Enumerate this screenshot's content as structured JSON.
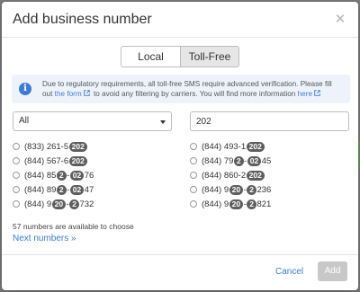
{
  "modal": {
    "title": "Add business number",
    "close_icon": "close-icon"
  },
  "tabs": [
    {
      "label": "Local",
      "active": false
    },
    {
      "label": "Toll-Free",
      "active": true
    }
  ],
  "notice": {
    "icon": "info-icon",
    "text_1": "Due to regulatory requirements, all toll-free SMS require advanced verification. Please fill out ",
    "link_1": "the form",
    "text_2": " to avoid any filtering by carriers. You will find more information ",
    "link_2": "here"
  },
  "filter": {
    "selected": "All",
    "search_value": "202"
  },
  "numbers": {
    "left": [
      [
        {
          "t": "(833) 261-5",
          "h": false
        },
        {
          "t": "202",
          "h": true
        }
      ],
      [
        {
          "t": "(844) 567-6",
          "h": false
        },
        {
          "t": "202",
          "h": true
        }
      ],
      [
        {
          "t": "(844) 85",
          "h": false
        },
        {
          "t": "2",
          "h": true
        },
        {
          "t": "-",
          "h": false
        },
        {
          "t": "02",
          "h": true
        },
        {
          "t": "76",
          "h": false
        }
      ],
      [
        {
          "t": "(844) 89",
          "h": false
        },
        {
          "t": "2",
          "h": true
        },
        {
          "t": "-",
          "h": false
        },
        {
          "t": "02",
          "h": true
        },
        {
          "t": "47",
          "h": false
        }
      ],
      [
        {
          "t": "(844) 9",
          "h": false
        },
        {
          "t": "20",
          "h": true
        },
        {
          "t": "-",
          "h": false
        },
        {
          "t": "2",
          "h": true
        },
        {
          "t": "732",
          "h": false
        }
      ]
    ],
    "right": [
      [
        {
          "t": "(844) 493-1",
          "h": false
        },
        {
          "t": "202",
          "h": true
        }
      ],
      [
        {
          "t": "(844) 79",
          "h": false
        },
        {
          "t": "2",
          "h": true
        },
        {
          "t": "-",
          "h": false
        },
        {
          "t": "02",
          "h": true
        },
        {
          "t": "45",
          "h": false
        }
      ],
      [
        {
          "t": "(844) 860-2",
          "h": false
        },
        {
          "t": "202",
          "h": true
        }
      ],
      [
        {
          "t": "(844) 9",
          "h": false
        },
        {
          "t": "20",
          "h": true
        },
        {
          "t": "-",
          "h": false
        },
        {
          "t": "2",
          "h": true
        },
        {
          "t": "236",
          "h": false
        }
      ],
      [
        {
          "t": "(844) 9",
          "h": false
        },
        {
          "t": "20",
          "h": true
        },
        {
          "t": "-",
          "h": false
        },
        {
          "t": "2",
          "h": true
        },
        {
          "t": "821",
          "h": false
        }
      ]
    ]
  },
  "available_text": "57 numbers are available to choose",
  "next_link": "Next numbers »",
  "footer": {
    "cancel_label": "Cancel",
    "add_label": "Add"
  },
  "colors": {
    "accent": "#3d7bd6",
    "highlight": "#5e5e5e"
  }
}
